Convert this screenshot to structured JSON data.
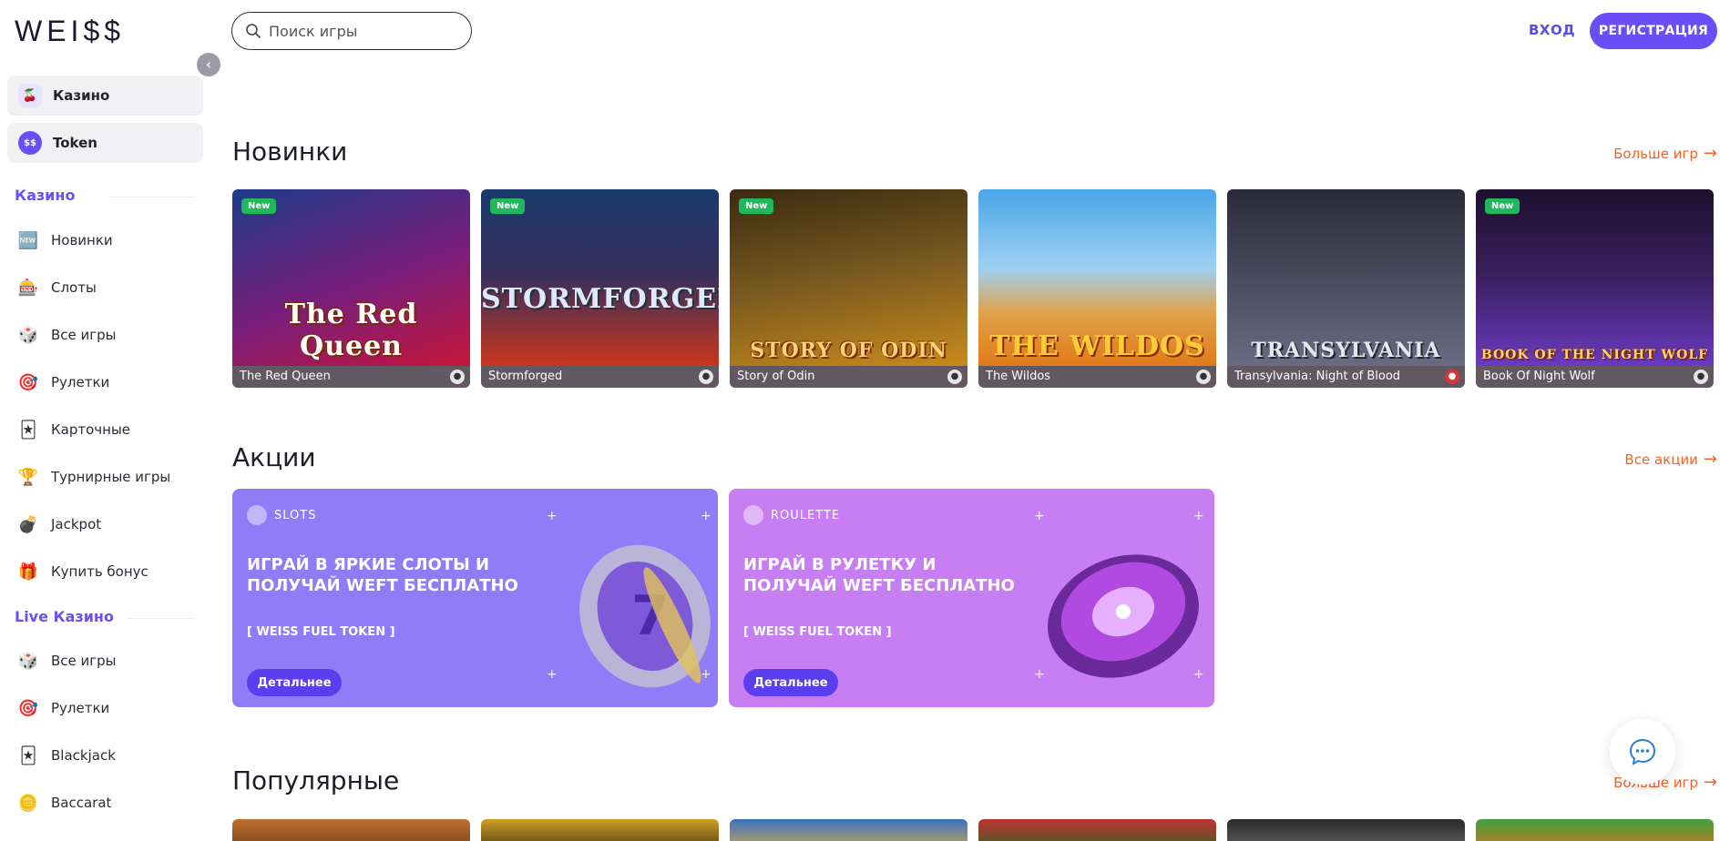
{
  "brand": {
    "logo": "WEI$$"
  },
  "sidebar": {
    "collapse_icon": "chevron-left-icon",
    "top_items": [
      {
        "label": "Казино",
        "icon": "cherry-icon"
      },
      {
        "label": "Token",
        "icon": "token-icon",
        "icon_text": "$$"
      }
    ],
    "casino_title": "Казино",
    "casino_items": [
      {
        "label": "Новинки",
        "icon": "new-icon"
      },
      {
        "label": "Слоты",
        "icon": "slot-icon"
      },
      {
        "label": "Все игры",
        "icon": "dice-icon"
      },
      {
        "label": "Рулетки",
        "icon": "roulette-icon"
      },
      {
        "label": "Карточные",
        "icon": "cards-icon"
      },
      {
        "label": "Турнирные игры",
        "icon": "trophy-icon"
      },
      {
        "label": "Jackpot",
        "icon": "bomb-icon"
      },
      {
        "label": "Купить бонус",
        "icon": "bonus-icon"
      }
    ],
    "live_title": "Live Казино",
    "live_items": [
      {
        "label": "Все игры",
        "icon": "dice-icon"
      },
      {
        "label": "Рулетки",
        "icon": "roulette-icon"
      },
      {
        "label": "Blackjack",
        "icon": "cards-icon"
      },
      {
        "label": "Baccarat",
        "icon": "chips-icon"
      }
    ]
  },
  "header": {
    "search_placeholder": "Поиск игры",
    "login_label": "ВХОД",
    "register_label": "РЕГИСТРАЦИЯ"
  },
  "new_games": {
    "title": "Новинки",
    "more_label": "Больше игр",
    "badge": "New",
    "games": [
      {
        "name": "The Red Queen",
        "art": "The Red Queen",
        "new": true,
        "colors": [
          "#1d3b8a",
          "#c4173a"
        ]
      },
      {
        "name": "Stormforged",
        "art": "STORMFORGED",
        "new": true,
        "colors": [
          "#1a3a6e",
          "#c8351c"
        ]
      },
      {
        "name": "Story of Odin",
        "art": "STORY OF ODIN",
        "new": true,
        "colors": [
          "#3a2a10",
          "#c98a1b"
        ]
      },
      {
        "name": "The Wildos",
        "art": "THE WILDOS",
        "new": false,
        "colors": [
          "#4aa6e8",
          "#e07b1a"
        ]
      },
      {
        "name": "Transylvania: Night of Blood",
        "art": "TRANSYLVANIA",
        "new": false,
        "colors": [
          "#2a2a3a",
          "#6a6a82"
        ]
      },
      {
        "name": "Book Of Night Wolf",
        "art": "BOOK OF THE NIGHT WOLF",
        "new": true,
        "colors": [
          "#1e1030",
          "#6a3ac0"
        ]
      }
    ]
  },
  "promotions": {
    "title": "Акции",
    "more_label": "Все акции",
    "items": [
      {
        "tag": "SLOTS",
        "title": "ИГРАЙ В ЯРКИЕ СЛОТЫ И ПОЛУЧАЙ WEFT БЕСПЛАТНО",
        "sub": "[ WEISS FUEL TOKEN ]",
        "button": "Детальнее",
        "color": "#8f7cf6"
      },
      {
        "tag": "ROULETTE",
        "title": "ИГРАЙ В РУЛЕТКУ И ПОЛУЧАЙ WEFT БЕСПЛАТНО",
        "sub": "[ WEISS FUEL TOKEN ]",
        "button": "Детальнее",
        "color": "#c77ef2"
      }
    ]
  },
  "popular": {
    "title": "Популярные",
    "more_label": "Больше игр"
  },
  "chat": {
    "icon": "chat-icon"
  }
}
